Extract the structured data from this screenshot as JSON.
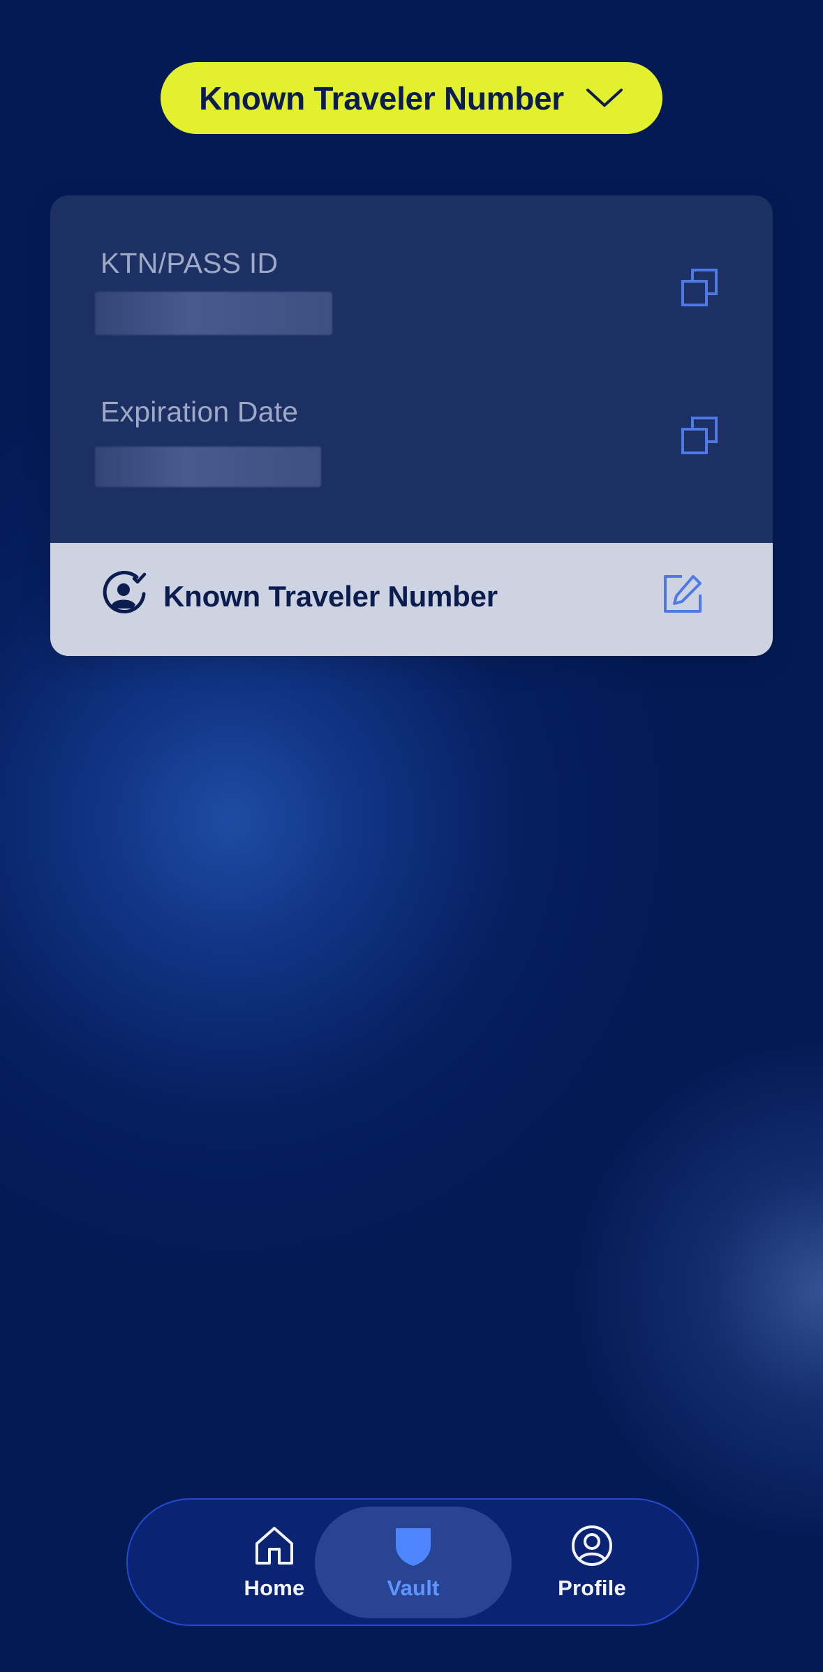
{
  "header": {
    "document_select_label": "Known Traveler Number"
  },
  "card": {
    "fields": [
      {
        "label": "KTN/PASS ID"
      },
      {
        "label": "Expiration Date"
      }
    ],
    "footer_label": "Known Traveler Number"
  },
  "nav": {
    "items": [
      {
        "label": "Home"
      },
      {
        "label": "Vault"
      },
      {
        "label": "Profile"
      }
    ]
  },
  "colors": {
    "background": "#031a55",
    "accent_yellow": "#e3f02e",
    "card": "#1d3063",
    "card_footer": "#cdd3e0",
    "icon_blue": "#4f7ae6",
    "nav_active": "#5f95ff"
  }
}
